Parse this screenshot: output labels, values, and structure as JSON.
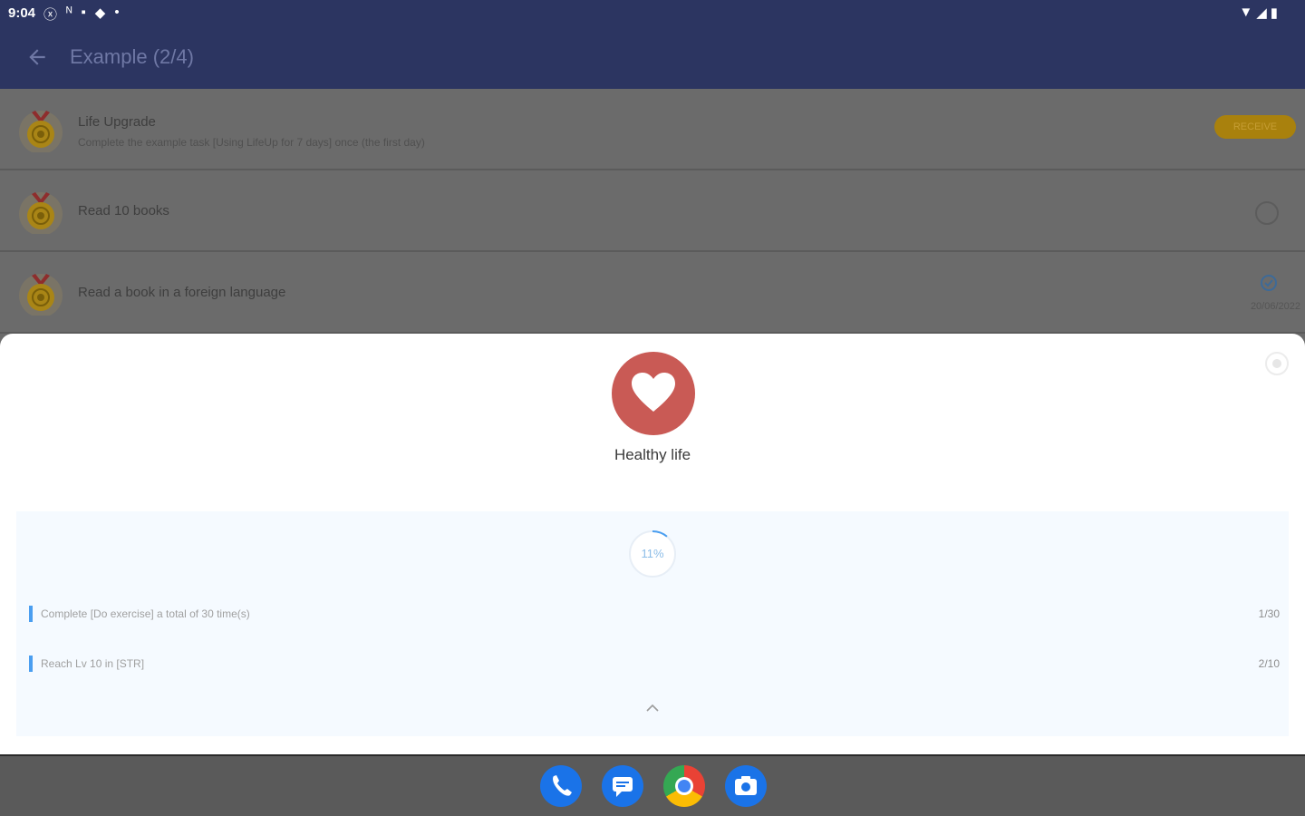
{
  "status_bar": {
    "time": "9:04",
    "left_icons": [
      "ⓧ",
      "ᴺ",
      "▪",
      "◆",
      "•"
    ],
    "right_icons": [
      "▼",
      "◢",
      "▮"
    ]
  },
  "app_bar": {
    "back_icon": "arrow-left-icon",
    "title": "Example (2/4)"
  },
  "achievements": [
    {
      "name": "Life Upgrade",
      "description": "Complete the example task [Using LifeUp for 7 days] once (the first day)",
      "action_label": "RECEIVE"
    },
    {
      "name": "Read 10 books"
    },
    {
      "name": "Read a book in a foreign language",
      "completed_date": "20/06/2022"
    }
  ],
  "sheet": {
    "category": "Healthy life",
    "progress_label": "11%",
    "progress_value": 0.11,
    "tasks": [
      {
        "label": "Complete [Do exercise] a total of 30 time(s)",
        "count": "1/30"
      },
      {
        "label": "Reach Lv 10 in [STR]",
        "count": "2/10"
      }
    ],
    "collapse_icon": "chevron-up-icon"
  },
  "colors": {
    "header": "#2c3561",
    "heart": "#c95a55",
    "accent": "#4a9ef0",
    "receive": "#a9810d"
  },
  "dock": {
    "apps": [
      "phone-icon",
      "messages-icon",
      "chrome-icon",
      "camera-icon"
    ]
  }
}
